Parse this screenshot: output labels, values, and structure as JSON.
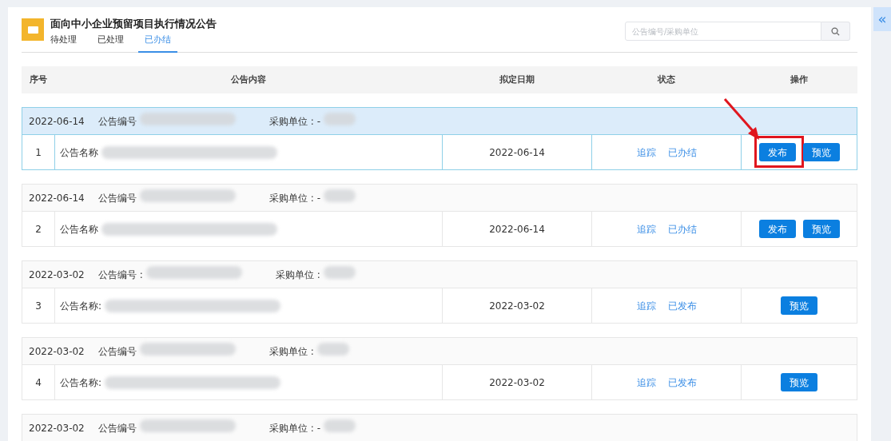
{
  "header": {
    "title": "面向中小企业预留项目执行情况公告"
  },
  "tabs": [
    {
      "label": "待处理",
      "selected": false
    },
    {
      "label": "已处理",
      "selected": false
    },
    {
      "label": "已办结",
      "selected": true
    }
  ],
  "search": {
    "placeholder": "公告编号/采购单位"
  },
  "sidebar_toggle": {
    "label": "«"
  },
  "table": {
    "columns": [
      "序号",
      "公告内容",
      "拟定日期",
      "状态",
      "操作"
    ],
    "rows": [
      {
        "date": "2022-06-14",
        "number_label": "公告编号",
        "unit_label": "采购单位 : -",
        "index": "1",
        "name_label": "公告名称",
        "planned_date": "2022-06-14",
        "track": "追踪",
        "status": "已办结",
        "selected": true,
        "annotated": true,
        "buttons": [
          {
            "label": "发布"
          },
          {
            "label": "预览"
          }
        ]
      },
      {
        "date": "2022-06-14",
        "number_label": "公告编号",
        "unit_label": "采购单位 : -",
        "index": "2",
        "name_label": "公告名称",
        "planned_date": "2022-06-14",
        "track": "追踪",
        "status": "已办结",
        "selected": false,
        "annotated": false,
        "buttons": [
          {
            "label": "发布"
          },
          {
            "label": "预览"
          }
        ]
      },
      {
        "date": "2022-03-02",
        "number_label": "公告编号 :",
        "unit_label": "采购单位 :",
        "index": "3",
        "name_label": "公告名称:",
        "planned_date": "2022-03-02",
        "track": "追踪",
        "status": "已发布",
        "selected": false,
        "annotated": false,
        "buttons": [
          {
            "label": "预览"
          }
        ]
      },
      {
        "date": "2022-03-02",
        "number_label": "公告编号",
        "unit_label": "采购单位 :",
        "index": "4",
        "name_label": "公告名称:",
        "planned_date": "2022-03-02",
        "track": "追踪",
        "status": "已发布",
        "selected": false,
        "annotated": false,
        "buttons": [
          {
            "label": "预览"
          }
        ]
      },
      {
        "date": "2022-03-02",
        "number_label": "公告编号",
        "unit_label": "采购单位 : -",
        "selected": false
      }
    ]
  }
}
